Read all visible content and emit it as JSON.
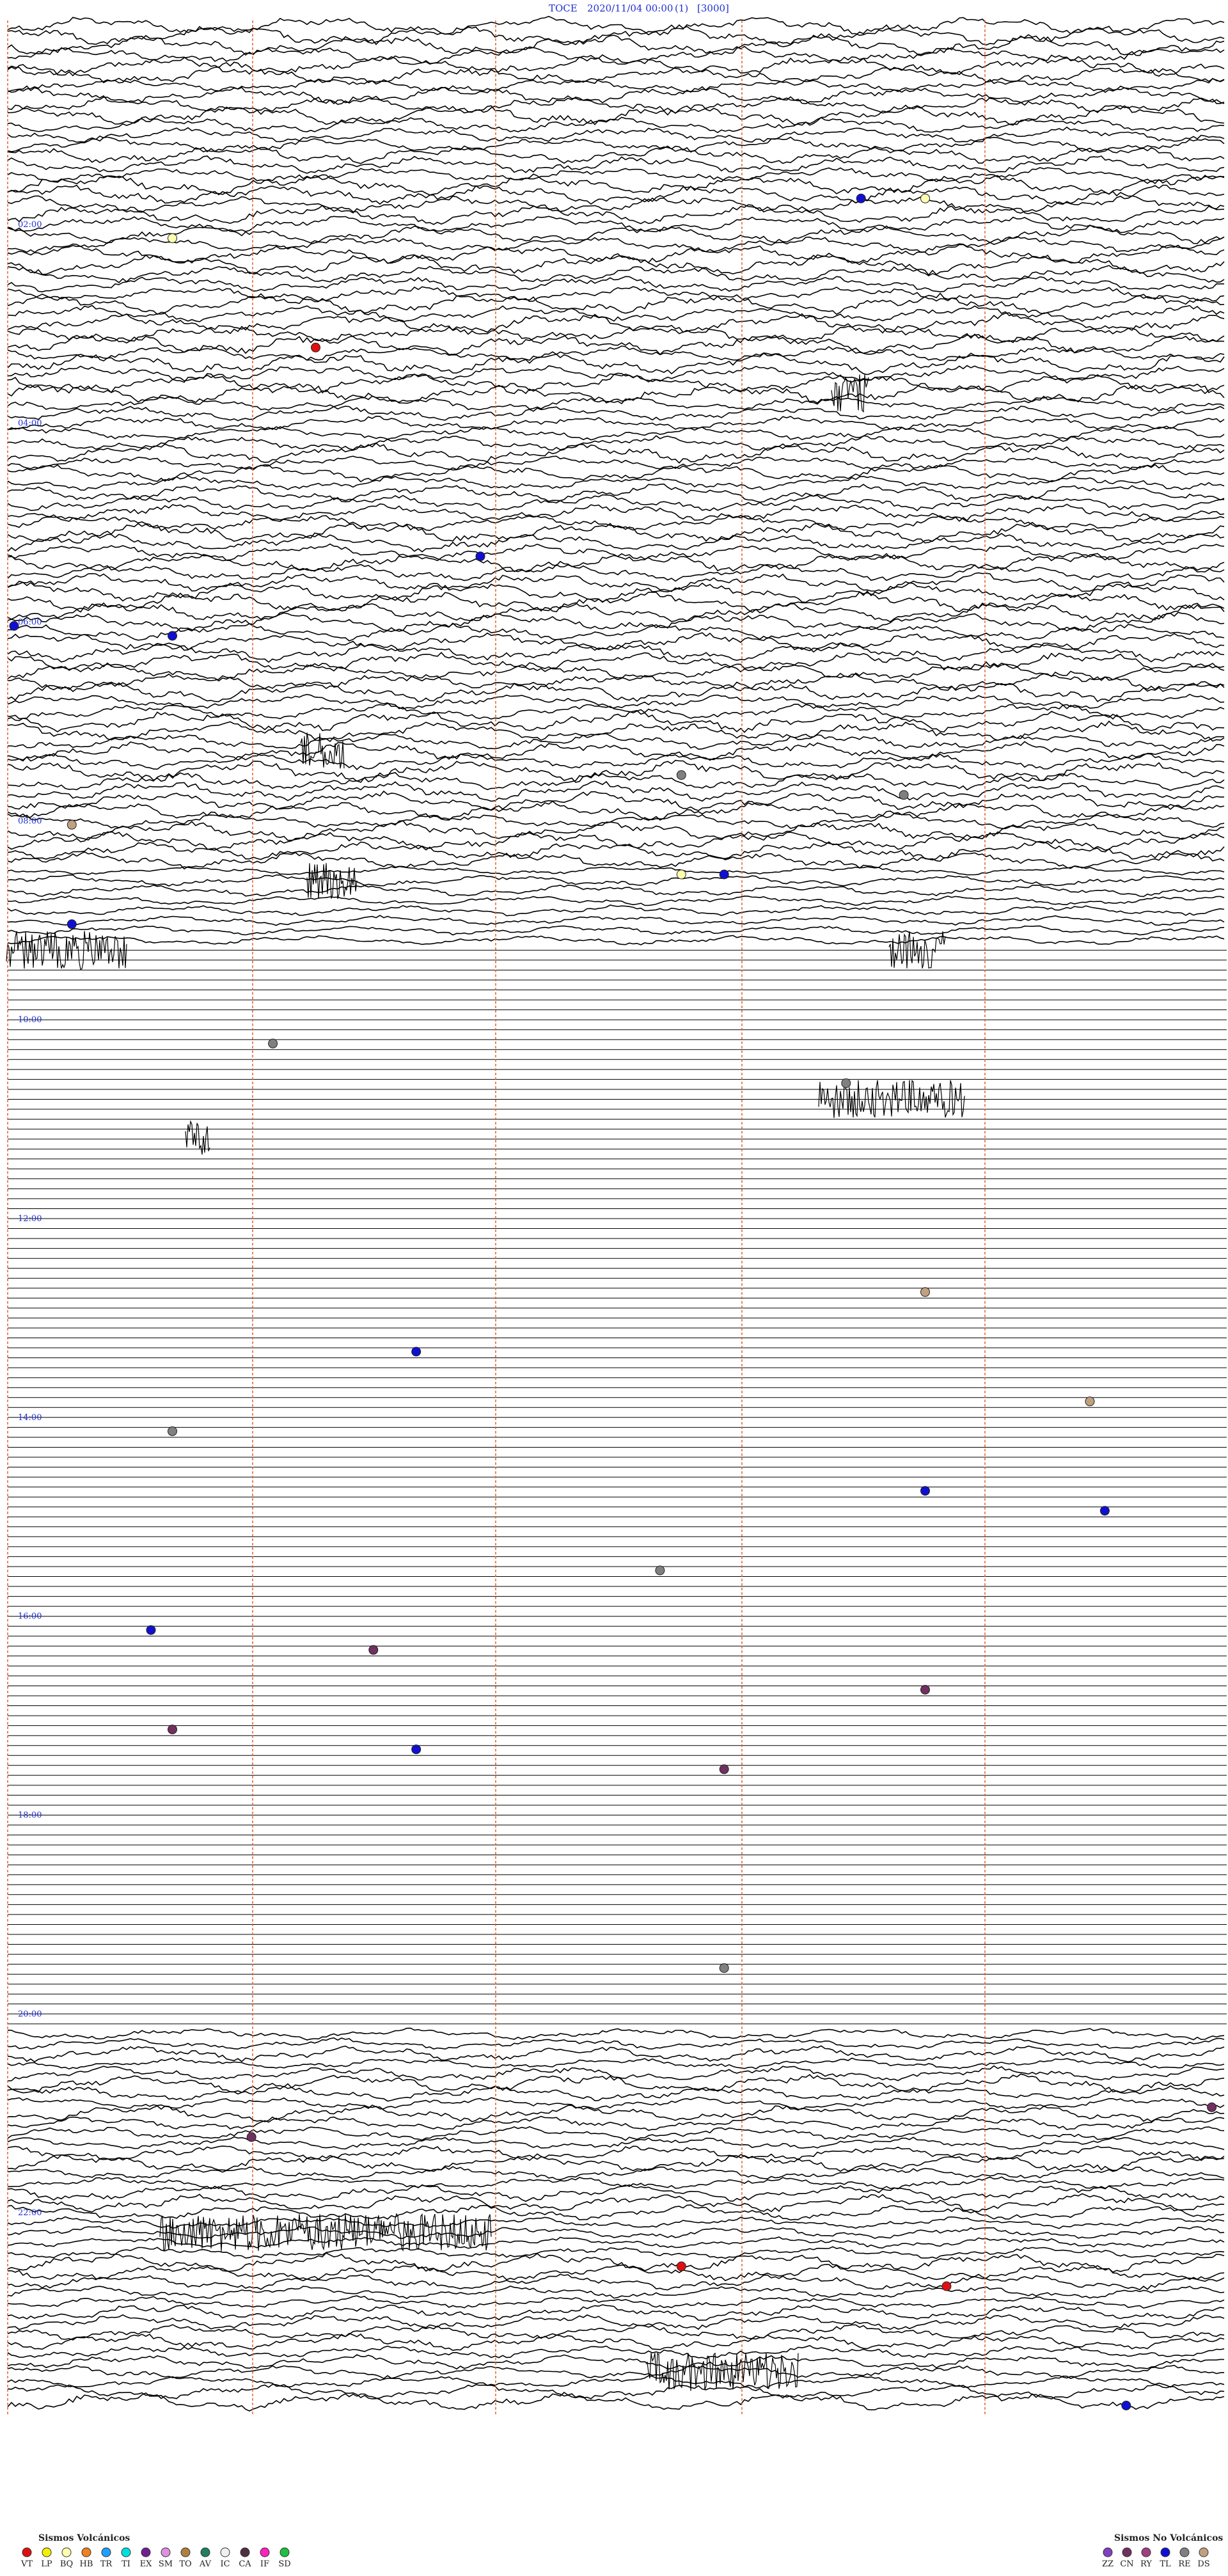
{
  "header": {
    "station": "TOCE",
    "datetime": "2020/11/04 00:00",
    "channel": "(1)",
    "scale": "[3000]"
  },
  "hour_labels": [
    "02:00",
    "04:00",
    "06:00",
    "08:00",
    "10:00",
    "12:00",
    "14:00",
    "16:00",
    "18:00",
    "20:00",
    "22:00"
  ],
  "traces": {
    "count": 24,
    "minutes_per_line": 60,
    "quiet_intervals": [
      "09:00–20:00"
    ]
  },
  "legend_volcanic": {
    "title": "Sismos Volcánicos",
    "items": [
      {
        "code": "VT",
        "color": "#e01010"
      },
      {
        "code": "LP",
        "color": "#f0f000"
      },
      {
        "code": "BQ",
        "color": "#ffffb0"
      },
      {
        "code": "HB",
        "color": "#f08020"
      },
      {
        "code": "TR",
        "color": "#20a0ff"
      },
      {
        "code": "TI",
        "color": "#00e0e0"
      },
      {
        "code": "EX",
        "color": "#702090"
      },
      {
        "code": "SM",
        "color": "#e090e0"
      },
      {
        "code": "TO",
        "color": "#b08040"
      },
      {
        "code": "AV",
        "color": "#208060"
      },
      {
        "code": "IC",
        "color": "#f0f0f0"
      },
      {
        "code": "CA",
        "color": "#503040"
      },
      {
        "code": "IF",
        "color": "#ff20c0"
      },
      {
        "code": "SD",
        "color": "#20c040"
      }
    ]
  },
  "legend_nonvolcanic": {
    "title": "Sismos No Volcánicos",
    "items": [
      {
        "code": "ZZ",
        "color": "#8040c0"
      },
      {
        "code": "CN",
        "color": "#703060"
      },
      {
        "code": "RY",
        "color": "#a04080"
      },
      {
        "code": "TL",
        "color": "#1010d0"
      },
      {
        "code": "RE",
        "color": "#808080"
      },
      {
        "code": "DS",
        "color": "#c0a080"
      }
    ]
  },
  "event_markers": [
    {
      "time": "01:42",
      "type": "TL"
    },
    {
      "time": "01:45",
      "type": "BQ"
    },
    {
      "time": "02:08",
      "type": "BQ"
    },
    {
      "time": "03:15",
      "type": "VT"
    },
    {
      "time": "05:23",
      "type": "TL"
    },
    {
      "time": "06:00",
      "type": "TL"
    },
    {
      "time": "06:08",
      "type": "TL"
    },
    {
      "time": "07:33",
      "type": "RE"
    },
    {
      "time": "07:44",
      "type": "RE"
    },
    {
      "time": "08:03",
      "type": "DS"
    },
    {
      "time": "08:33",
      "type": "BQ"
    },
    {
      "time": "08:35",
      "type": "TL"
    },
    {
      "time": "09:03",
      "type": "TL"
    },
    {
      "time": "10:13",
      "type": "RE"
    },
    {
      "time": "10:41",
      "type": "RE"
    },
    {
      "time": "12:45",
      "type": "DS"
    },
    {
      "time": "13:20",
      "type": "TL"
    },
    {
      "time": "13:53",
      "type": "DS"
    },
    {
      "time": "14:08",
      "type": "RE"
    },
    {
      "time": "14:45",
      "type": "TL"
    },
    {
      "time": "14:54",
      "type": "TL"
    },
    {
      "time": "15:32",
      "type": "RE"
    },
    {
      "time": "16:07",
      "type": "TL"
    },
    {
      "time": "16:18",
      "type": "CN"
    },
    {
      "time": "16:45",
      "type": "CN"
    },
    {
      "time": "17:08",
      "type": "CN"
    },
    {
      "time": "17:20",
      "type": "TL"
    },
    {
      "time": "17:35",
      "type": "CN"
    },
    {
      "time": "19:35",
      "type": "RE"
    },
    {
      "time": "20:59",
      "type": "CN"
    },
    {
      "time": "21:12",
      "type": "CN"
    },
    {
      "time": "22:33",
      "type": "VT"
    },
    {
      "time": "22:46",
      "type": "VT"
    },
    {
      "time": "23:55",
      "type": "TL"
    }
  ]
}
